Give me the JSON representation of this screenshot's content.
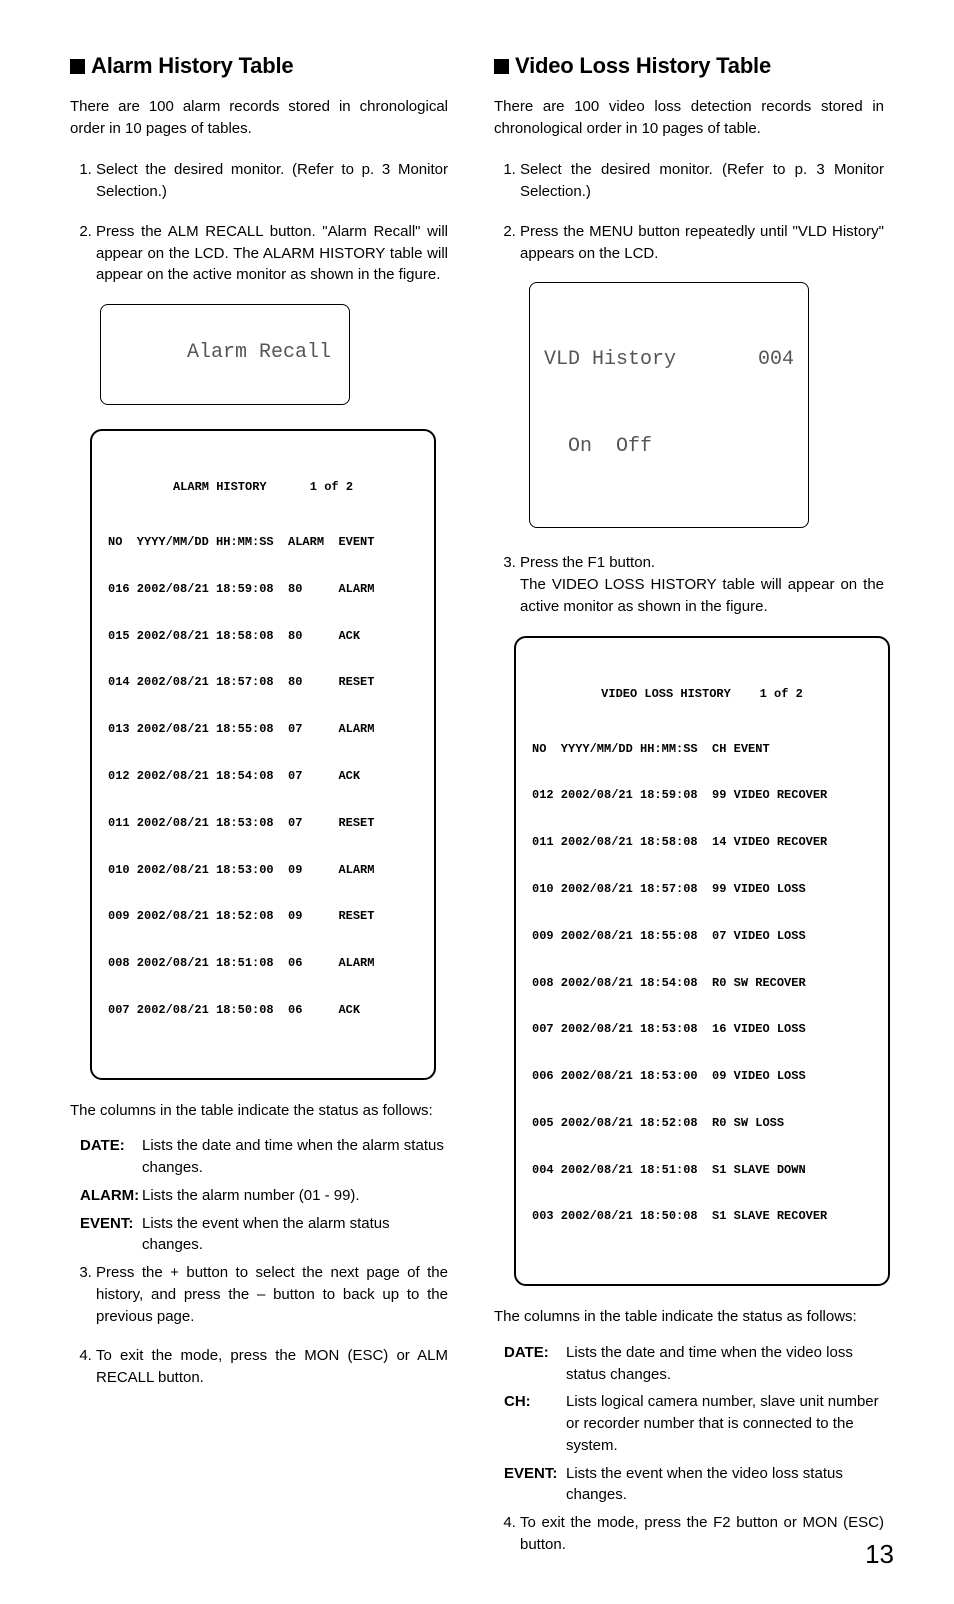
{
  "left": {
    "heading": "Alarm History Table",
    "intro": "There are 100 alarm records stored in chronological order in 10 pages of tables.",
    "step1": "Select the desired monitor. (Refer to p. 3 Monitor Selection.)",
    "step2": "Press the ALM RECALL button. \"Alarm Recall\" will appear on the LCD. The ALARM HISTORY table will appear on the active monitor as shown in the figure.",
    "lcd_line": "Alarm Recall",
    "history_title": "ALARM HISTORY      1 of 2",
    "history_header": "NO  YYYY/MM/DD HH:MM:SS  ALARM  EVENT",
    "rows": [
      "016 2002/08/21 18:59:08  80     ALARM",
      "015 2002/08/21 18:58:08  80     ACK",
      "014 2002/08/21 18:57:08  80     RESET",
      "013 2002/08/21 18:55:08  07     ALARM",
      "012 2002/08/21 18:54:08  07     ACK",
      "011 2002/08/21 18:53:08  07     RESET",
      "010 2002/08/21 18:53:00  09     ALARM",
      "009 2002/08/21 18:52:08  09     RESET",
      "008 2002/08/21 18:51:08  06     ALARM",
      "007 2002/08/21 18:50:08  06     ACK"
    ],
    "caption": "The columns in the table indicate the status as follows:",
    "def_date_term": "DATE:",
    "def_date": "Lists the date and time when the alarm status changes.",
    "def_alarm_term": "ALARM:",
    "def_alarm": "Lists the alarm number (01 - 99).",
    "def_event_term": "EVENT:",
    "def_event": "Lists the event when the alarm status changes.",
    "step3": "Press the + button to select the next page of the history, and press the – button to back up to the previous page.",
    "step4": "To exit the mode, press the MON (ESC) or ALM RECALL button."
  },
  "right": {
    "heading": "Video Loss History Table",
    "intro": "There are 100 video loss detection records stored in chronological order in 10 pages of table.",
    "step1": "Select the desired monitor. (Refer to p. 3 Monitor Selection.)",
    "step2": "Press the MENU button repeatedly until \"VLD History\" appears on the LCD.",
    "lcd_title": "VLD History",
    "lcd_num": "004",
    "lcd_line2": "  On  Off",
    "step3a": "Press the F1 button.",
    "step3b": "The VIDEO LOSS HISTORY table will appear on the active monitor as shown in the figure.",
    "history_title": "VIDEO LOSS HISTORY    1 of 2",
    "history_header": "NO  YYYY/MM/DD HH:MM:SS  CH EVENT",
    "rows": [
      "012 2002/08/21 18:59:08  99 VIDEO RECOVER",
      "011 2002/08/21 18:58:08  14 VIDEO RECOVER",
      "010 2002/08/21 18:57:08  99 VIDEO LOSS",
      "009 2002/08/21 18:55:08  07 VIDEO LOSS",
      "008 2002/08/21 18:54:08  R0 SW RECOVER",
      "007 2002/08/21 18:53:08  16 VIDEO LOSS",
      "006 2002/08/21 18:53:00  09 VIDEO LOSS",
      "005 2002/08/21 18:52:08  R0 SW LOSS",
      "004 2002/08/21 18:51:08  S1 SLAVE DOWN",
      "003 2002/08/21 18:50:08  S1 SLAVE RECOVER"
    ],
    "caption": "The columns in the table indicate the status as follows:",
    "def_date_term": "DATE:",
    "def_date": "Lists the date and time when the video loss status changes.",
    "def_ch_term": "CH:",
    "def_ch": "Lists logical camera number, slave unit number or recorder number that is connected to the system.",
    "def_event_term": "EVENT:",
    "def_event": "Lists the event when the video loss status changes.",
    "step4": "To exit the mode, press the F2 button or MON (ESC) button."
  },
  "page_no": "13"
}
